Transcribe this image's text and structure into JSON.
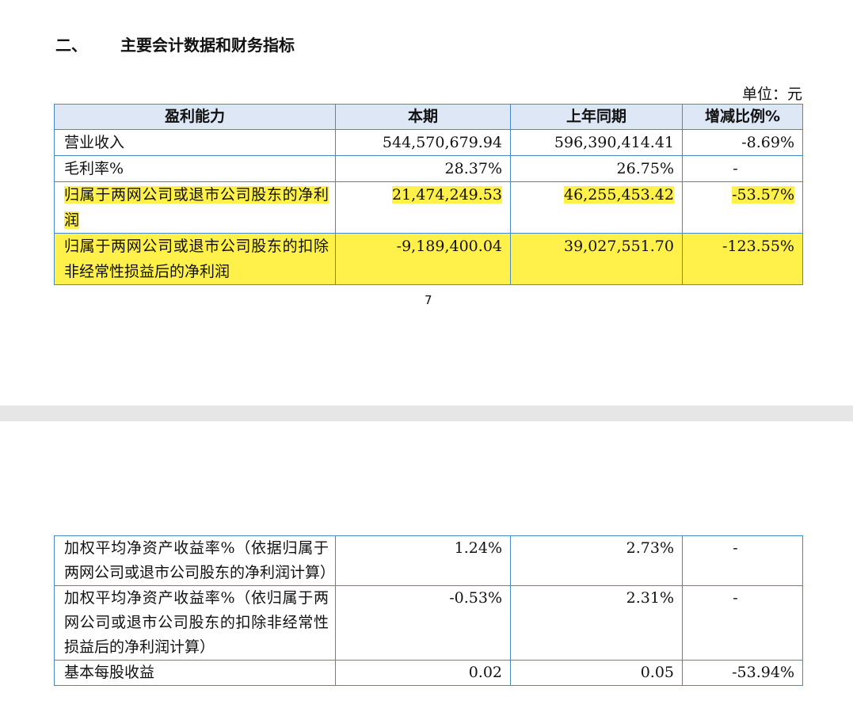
{
  "section": {
    "number": "二、",
    "title": "主要会计数据和财务指标"
  },
  "unit_label": "单位：元",
  "page_number": "7",
  "table": {
    "headers": [
      "盈利能力",
      "本期",
      "上年同期",
      "增减比例%"
    ],
    "rows_page1": [
      {
        "label": "营业收入",
        "current": "544,570,679.94",
        "prior": "596,390,414.41",
        "change": "-8.69%",
        "highlight": false
      },
      {
        "label": "毛利率%",
        "current": "28.37%",
        "prior": "26.75%",
        "change": "-",
        "highlight": false
      },
      {
        "label": "归属于两网公司或退市公司股东的净利润",
        "current": "21,474,249.53",
        "prior": "46,255,453.42",
        "change": "-53.57%",
        "highlight": true
      },
      {
        "label": "归属于两网公司或退市公司股东的扣除非经常性损益后的净利润",
        "current": "-9,189,400.04",
        "prior": "39,027,551.70",
        "change": "-123.55%",
        "highlight": true
      }
    ],
    "rows_page2": [
      {
        "label": "加权平均净资产收益率%（依据归属于两网公司或退市公司股东的净利润计算）",
        "current": "1.24%",
        "prior": "2.73%",
        "change": "-"
      },
      {
        "label": "加权平均净资产收益率%（依归属于两网公司或退市公司股东的扣除非经常性损益后的净利润计算）",
        "current": "-0.53%",
        "prior": "2.31%",
        "change": "-"
      },
      {
        "label": "基本每股收益",
        "current": "0.02",
        "prior": "0.05",
        "change": "-53.94%"
      }
    ]
  }
}
